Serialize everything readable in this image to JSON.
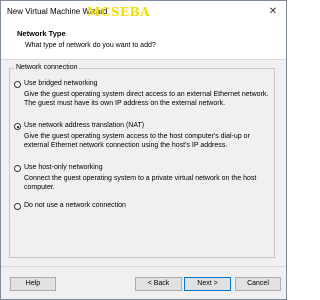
{
  "window": {
    "title": "New Virtual Machine Wizard",
    "watermark": "MCSEBA",
    "close_glyph": "✕"
  },
  "header": {
    "title": "Network Type",
    "subtitle": "What type of network do you want to add?"
  },
  "group": {
    "label": "Network connection"
  },
  "options": [
    {
      "label": "Use bridged networking",
      "description": "Give the guest operating system direct access to an external Ethernet network. The guest must have its own IP address on the external network.",
      "selected": false
    },
    {
      "label": "Use network address translation (NAT)",
      "description": "Give the guest operating system access to the host computer's dial-up or external Ethernet network connection using the host's IP address.",
      "selected": true
    },
    {
      "label": "Use host-only networking",
      "description": "Connect the guest operating system to a private virtual network on the host computer.",
      "selected": false
    },
    {
      "label": "Do not use a network connection",
      "description": "",
      "selected": false
    }
  ],
  "buttons": {
    "help": "Help",
    "back": "< Back",
    "next": "Next >",
    "cancel": "Cancel"
  },
  "colors": {
    "accent": "#0078d7",
    "watermark": "#f2de00"
  }
}
